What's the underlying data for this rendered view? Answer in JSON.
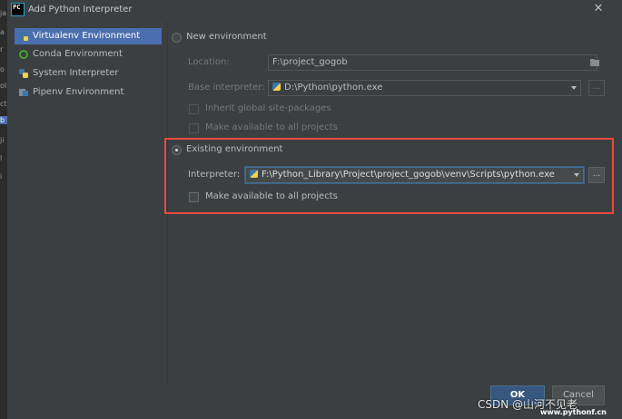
{
  "window": {
    "title": "Add Python Interpreter",
    "app_icon_text": "PC",
    "close_glyph": "✕"
  },
  "left_strip": [
    "ja",
    "a",
    "r",
    "o",
    "ol",
    "ct",
    "b",
    "ji",
    "l",
    "i"
  ],
  "sidebar": {
    "items": [
      {
        "label": "Virtualenv Environment",
        "icon": "virtualenv-icon",
        "selected": true
      },
      {
        "label": "Conda Environment",
        "icon": "conda-icon",
        "selected": false
      },
      {
        "label": "System Interpreter",
        "icon": "python-icon",
        "selected": false
      },
      {
        "label": "Pipenv Environment",
        "icon": "pipenv-icon",
        "selected": false
      }
    ]
  },
  "new_env": {
    "radio_label": "New environment",
    "location_label": "Location:",
    "location_value": "F:\\project_gogob",
    "base_interpreter_label": "Base interpreter:",
    "base_interpreter_value": "D:\\Python\\python.exe",
    "inherit_label": "Inherit global site-packages",
    "make_available_label": "Make available to all projects"
  },
  "existing_env": {
    "radio_label": "Existing environment",
    "interpreter_label": "Interpreter:",
    "interpreter_value": "F:\\Python_Library\\Project\\project_gogob\\venv\\Scripts\\python.exe",
    "browse_label": "...",
    "make_available_label": "Make available to all projects"
  },
  "buttons": {
    "ok": "OK",
    "cancel": "Cancel"
  },
  "watermark": {
    "text": "CSDN @山河不见老",
    "site": "www.pythonf.cn"
  },
  "colors": {
    "background": "#3c3f41",
    "selection": "#4b6eaf",
    "highlight_border": "#e84b3c",
    "ok_button": "#365880"
  }
}
